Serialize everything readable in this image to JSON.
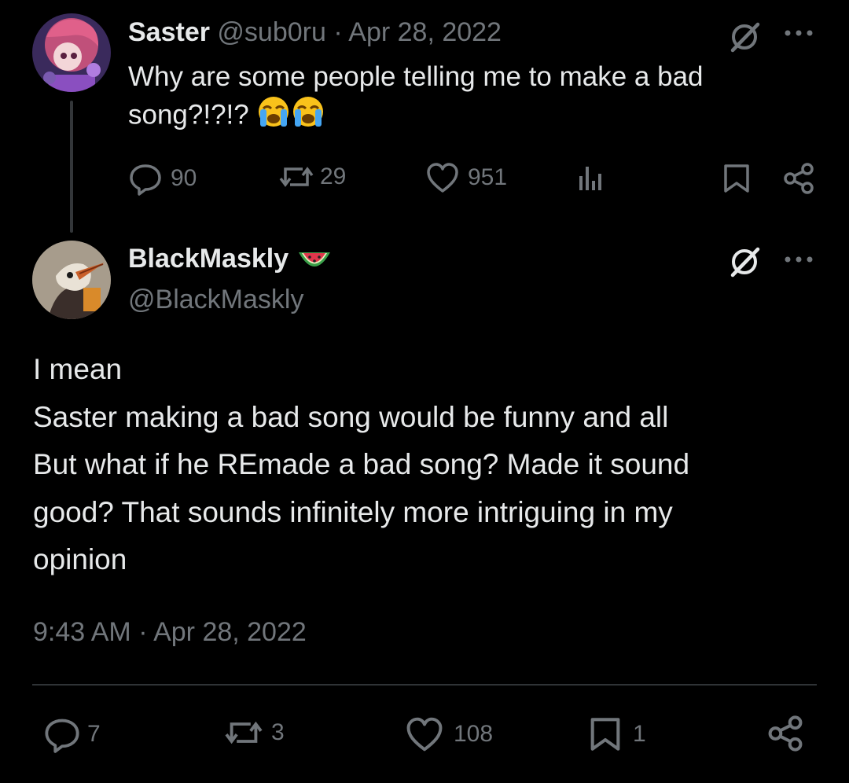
{
  "parent_tweet": {
    "display_name": "Saster",
    "handle": "@sub0ru",
    "separator": "·",
    "date": "Apr 28, 2022",
    "text": "Why are some people telling me to make a bad song?!?!?",
    "emojis": [
      "loudly-crying-face",
      "loudly-crying-face"
    ],
    "stats": {
      "replies": "90",
      "reposts": "29",
      "likes": "951"
    }
  },
  "main_tweet": {
    "display_name": "BlackMaskly",
    "name_emoji": "watermelon",
    "handle": "@BlackMaskly",
    "text_lines": [
      "I mean",
      "Saster making a bad song would be funny and all",
      "But what if he REmade a bad song? Made it sound",
      "good? That sounds infinitely more intriguing in my",
      "opinion"
    ],
    "timestamp": "9:43 AM · Apr 28, 2022",
    "stats": {
      "replies": "7",
      "reposts": "3",
      "likes": "108",
      "bookmarks": "1"
    }
  },
  "icons": {
    "reply": "reply-icon",
    "repost": "repost-icon",
    "like": "like-icon",
    "views": "views-icon",
    "bookmark": "bookmark-icon",
    "share": "share-icon",
    "more": "more-icon",
    "grok": "grok-icon"
  },
  "colors": {
    "background": "#000000",
    "text": "#e7e9ea",
    "muted": "#71767b",
    "divider": "#2f3336"
  }
}
